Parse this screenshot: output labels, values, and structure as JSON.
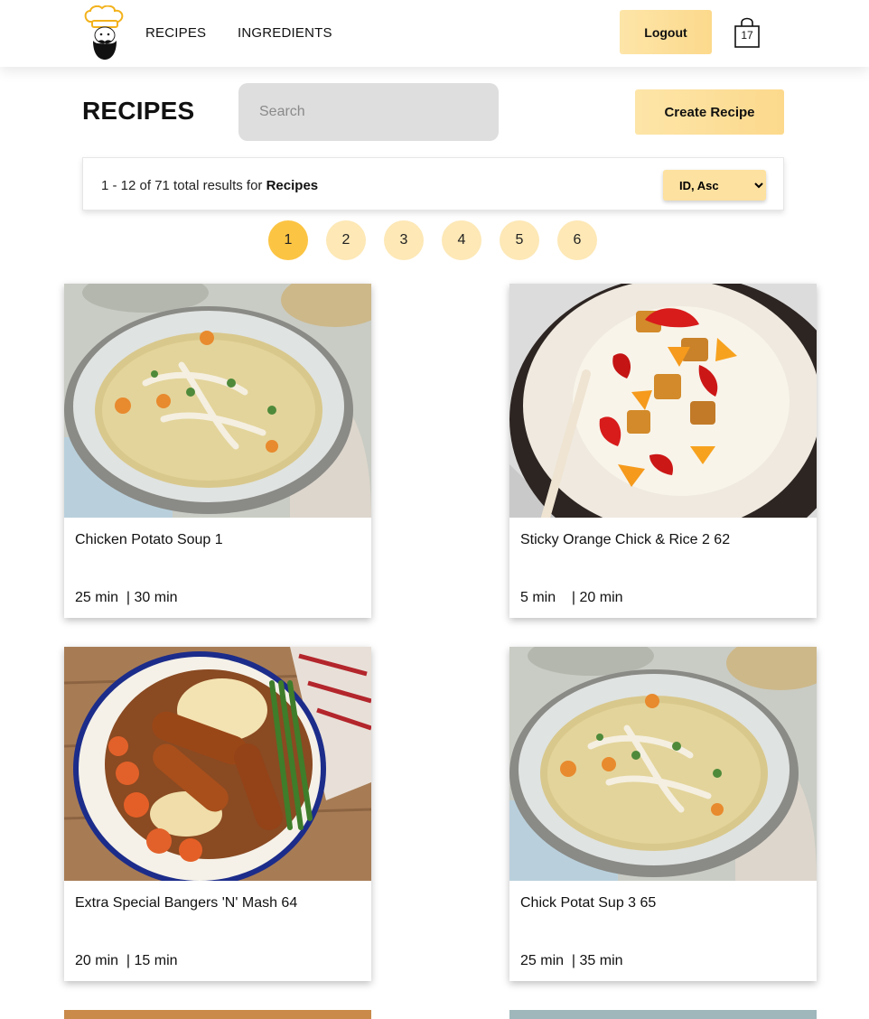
{
  "nav": {
    "links": [
      "RECIPES",
      "INGREDIENTS"
    ],
    "logout_label": "Logout",
    "cart_count": "17"
  },
  "header": {
    "title": "RECIPES",
    "search_placeholder": "Search",
    "create_label": "Create Recipe"
  },
  "results": {
    "range": "1 - 12 of 71 total results for ",
    "entity": "Recipes",
    "sort_selected": "ID, Asc"
  },
  "pagination": {
    "pages": [
      "1",
      "2",
      "3",
      "4",
      "5",
      "6"
    ],
    "current": "1"
  },
  "recipes": [
    {
      "name": "Chicken Potato Soup 1",
      "times": "25 min  | 30 min",
      "image": "soup"
    },
    {
      "name": "Sticky Orange Chick & Rice 2 62",
      "times": "5 min    | 20 min",
      "image": "sticky-orange"
    },
    {
      "name": "Extra Special Bangers 'N' Mash 64",
      "times": "20 min  | 15 min",
      "image": "bangers"
    },
    {
      "name": "Chick Potat Sup 3 65",
      "times": "25 min  | 35 min",
      "image": "soup"
    }
  ],
  "colors": {
    "accent": "#fbc443",
    "accent_light": "#fde8b6",
    "button": "#fcd98c"
  }
}
